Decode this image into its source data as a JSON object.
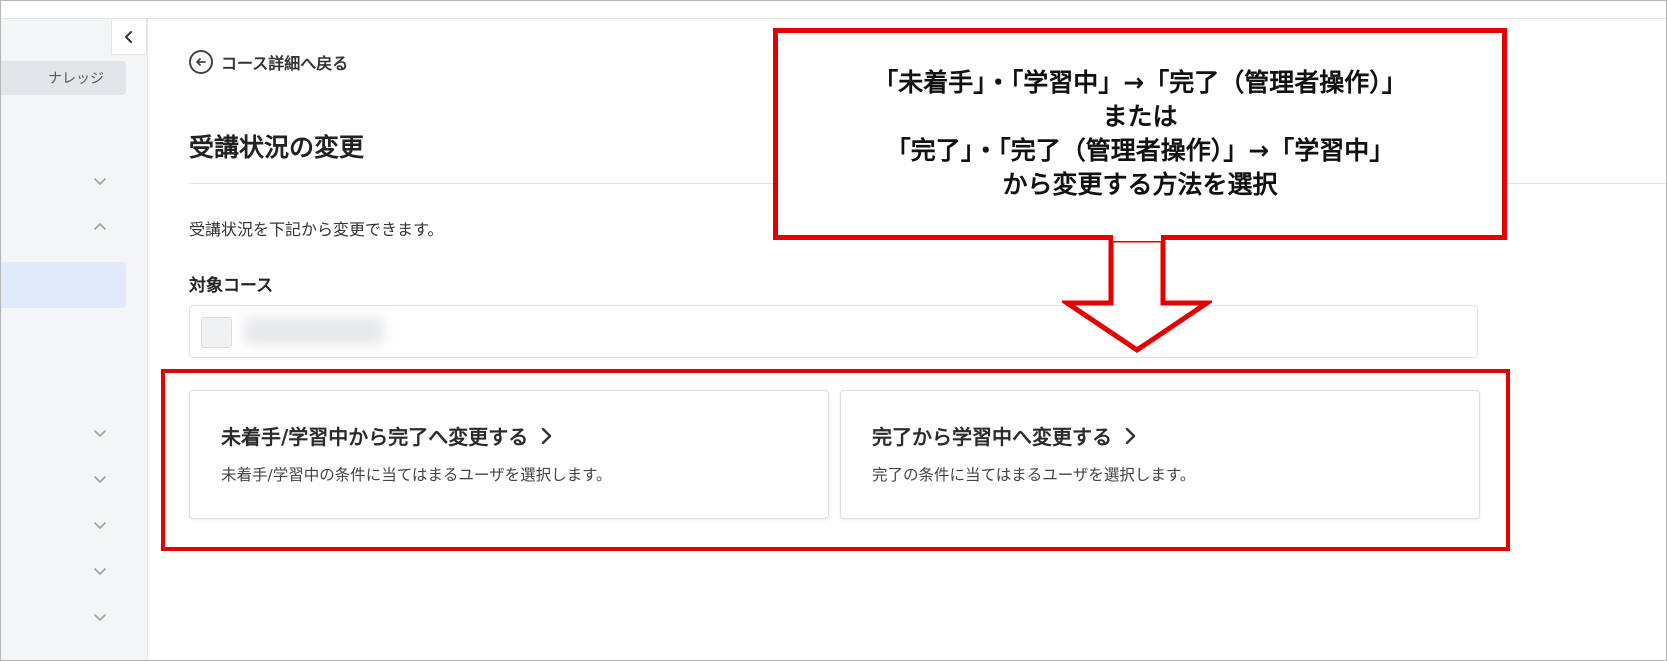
{
  "sidebar": {
    "collapse_icon": "chevron-left-icon",
    "items": [
      {
        "label": "ナレッジ"
      }
    ],
    "chevron_icon_down": "chevron-down-icon",
    "chevron_icon_up": "chevron-up-icon"
  },
  "header": {
    "back_label": "コース詳細へ戻る",
    "back_icon": "arrow-left-circle-icon"
  },
  "main": {
    "title": "受講状況の変更",
    "description": "受講状況を下記から変更できます。",
    "target_course_label": "対象コース"
  },
  "cards": [
    {
      "title": "未着手/学習中から完了へ変更する",
      "description": "未着手/学習中の条件に当てはまるユーザを選択します。"
    },
    {
      "title": "完了から学習中へ変更する",
      "description": "完了の条件に当てはまるユーザを選択します。"
    }
  ],
  "callout": {
    "lines": [
      "「未着手」・「学習中」→「完了（管理者操作）」",
      "または",
      "「完了」・「完了（管理者操作）」→「学習中」",
      "から変更する方法を選択"
    ]
  },
  "colors": {
    "annotation_red": "#e50000",
    "sidebar_bg": "#f4f5f7",
    "active_nav_bg": "#e2e9fb"
  }
}
